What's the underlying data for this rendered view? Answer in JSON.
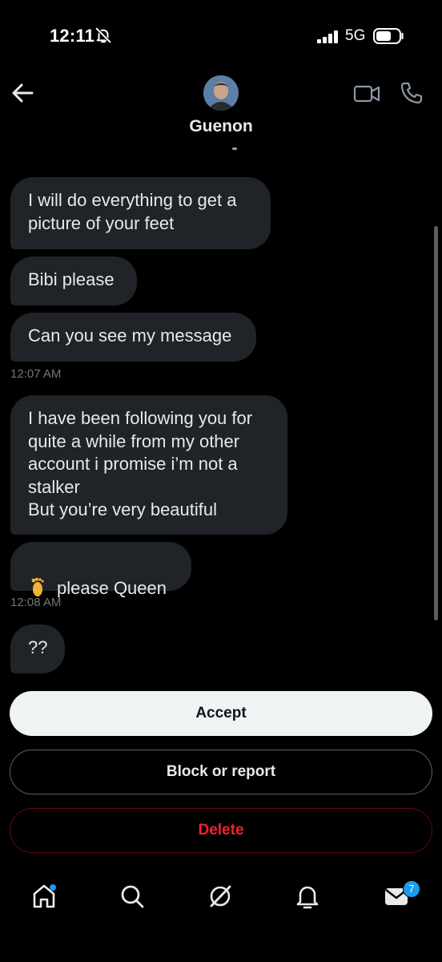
{
  "status_bar": {
    "time": "12:11",
    "network": "5G",
    "icons": [
      "bell-slash-icon",
      "cellular-signal-icon",
      "battery-icon"
    ]
  },
  "header": {
    "contact_name": "Guenon",
    "icons": [
      "back-arrow-icon",
      "video-call-icon",
      "phone-icon"
    ]
  },
  "messages": [
    {
      "text": "I will do everything to get a\npicture of your feet"
    },
    {
      "text": "Bibi please"
    },
    {
      "text": "Can you see my message"
    },
    {
      "timestamp": "12:07 AM"
    },
    {
      "text": "I have been following you for\nquite a while from my other\naccount i promise i’m not a\nstalker\nBut you’re very beautiful"
    },
    {
      "text": "please Queen",
      "emoji": "foot-emoji"
    },
    {
      "timestamp": "12:08 AM"
    },
    {
      "text": "??"
    }
  ],
  "actions": {
    "accept": "Accept",
    "block_or_report": "Block or report",
    "delete": "Delete"
  },
  "colors": {
    "background": "#000000",
    "bubble": "#202327",
    "accent_blue": "#1d9bf0",
    "danger_red": "#f4212e",
    "muted_text": "#71767b"
  },
  "tab_bar": {
    "tabs": [
      "home-icon",
      "search-icon",
      "grok-icon",
      "notifications-icon",
      "messages-icon"
    ],
    "messages_badge": "7"
  }
}
